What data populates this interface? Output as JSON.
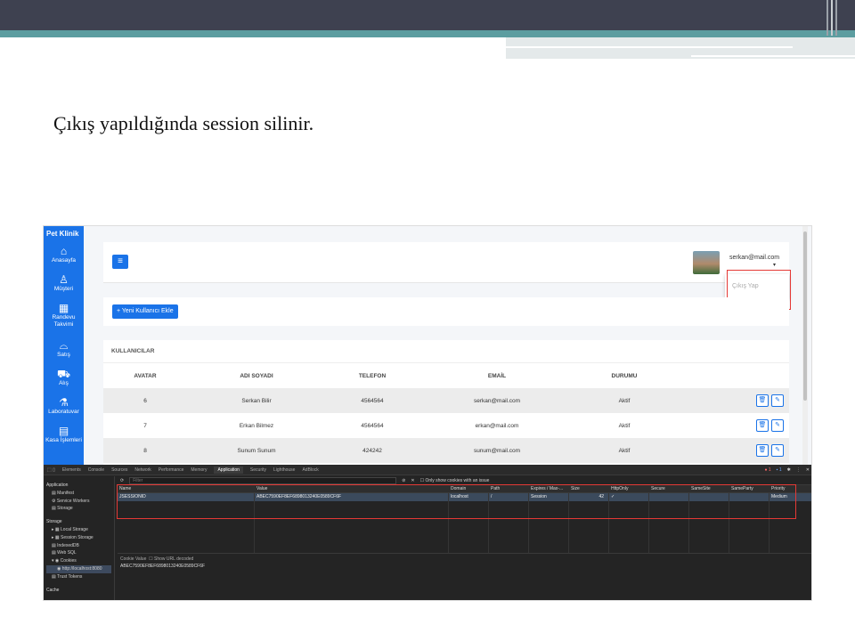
{
  "slide": {
    "title": "Çıkış yapıldığında session silinir."
  },
  "app": {
    "brand": "Pet Klinik",
    "sidebar": [
      {
        "icon": "home-icon",
        "glyph": "⌂",
        "label": "Anasayfa"
      },
      {
        "icon": "user-icon",
        "glyph": "♙",
        "label": "Müşteri"
      },
      {
        "icon": "calendar-icon",
        "glyph": "▦",
        "label": "Randevu Takvimi"
      },
      {
        "icon": "basket-icon",
        "glyph": "⌓",
        "label": "Satış"
      },
      {
        "icon": "truck-icon",
        "glyph": "⛟",
        "label": "Alış"
      },
      {
        "icon": "flask-icon",
        "glyph": "⚗",
        "label": "Laboratuvar"
      },
      {
        "icon": "cash-register-icon",
        "glyph": "▤",
        "label": "Kasa İşlemleri"
      }
    ],
    "header": {
      "menu_glyph": "≡",
      "user_email": "serkan@mail.com",
      "caret": "▾",
      "dropdown_item": "Çıkış Yap"
    },
    "add_button": "+ Yeni Kullanıcı Ekle",
    "table": {
      "title": "KULLANICILAR",
      "columns": [
        "AVATAR",
        "ADI SOYADI",
        "TELEFON",
        "EMAİL",
        "DURUMU"
      ],
      "rows": [
        {
          "id": "6",
          "name": "Serkan Bilir",
          "phone": "4564564",
          "email": "serkan@mail.com",
          "status": "Aktif"
        },
        {
          "id": "7",
          "name": "Erkan Bilmez",
          "phone": "4564564",
          "email": "erkan@mail.com",
          "status": "Aktif"
        },
        {
          "id": "8",
          "name": "Sunum Sunum",
          "phone": "424242",
          "email": "sunum@mail.com",
          "status": "Aktif"
        }
      ],
      "delete_glyph": "🗑",
      "edit_glyph": "✎"
    },
    "accent_color": "#1a73e8"
  },
  "devtools": {
    "tabs": [
      "Elements",
      "Console",
      "Sources",
      "Network",
      "Performance",
      "Memory",
      "Application",
      "Security",
      "Lighthouse",
      "AdBlock"
    ],
    "active_tab": "Application",
    "errors": "1",
    "messages": "1",
    "left_panel": {
      "application_header": "Application",
      "manifest": "Manifest",
      "service_workers": "Service Workers",
      "storage": "Storage",
      "storage_header": "Storage",
      "local_storage": "Local Storage",
      "session_storage": "Session Storage",
      "indexeddb": "IndexedDB",
      "web_sql": "Web SQL",
      "cookies": "Cookies",
      "cookie_origin": "http://localhost:8080",
      "trust_tokens": "Trust Tokens",
      "cache_header": "Cache"
    },
    "filter_placeholder": "Filter",
    "only_issue_label": "Only show cookies with an issue",
    "cookie_columns": [
      "Name",
      "Value",
      "Domain",
      "Path",
      "Expires / Max-...",
      "Size",
      "HttpOnly",
      "Secure",
      "SameSite",
      "SameParty",
      "Priority"
    ],
    "cookie_row": {
      "name": "JSESSIONID",
      "value": "ABEC7590EF8EF6898013240E0589CF6F",
      "domain": "localhost",
      "path": "/",
      "expires": "Session",
      "size": "42",
      "httponly": "✓",
      "secure": "",
      "samesite": "",
      "sameparty": "",
      "priority": "Medium"
    },
    "cookie_value_label": "Cookie Value",
    "show_url_decoded": "Show URL decoded",
    "cookie_value": "ABEC7590EF8EF6898013240E0589CF6F"
  }
}
